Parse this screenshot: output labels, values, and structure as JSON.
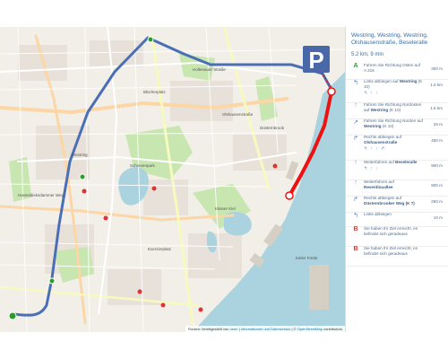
{
  "route": {
    "title": "Westring, Westring, Westring, Olshausenstraße, Beseleralle",
    "summary": "5.2 km, 9 min"
  },
  "steps": [
    {
      "icon": "A",
      "icon_name": "start-marker",
      "pre": "Fahren Sie Richtung Osten auf",
      "bold": "",
      "post": "A 215",
      "dist": "300 m",
      "lanes": ""
    },
    {
      "icon": "↰",
      "icon_name": "turn-left-icon",
      "pre": "Links abbiegen auf",
      "bold": "Westring",
      "post": "(K 10)",
      "dist": "1.5 km",
      "lanes": "↰ ↑ ↑"
    },
    {
      "icon": "↑",
      "icon_name": "straight-icon",
      "pre": "Fahren Sie Richtung Nordosten auf",
      "bold": "Westring",
      "post": "(K 10)",
      "dist": "1.5 km",
      "lanes": ""
    },
    {
      "icon": "↗",
      "icon_name": "slight-right-icon",
      "pre": "Fahren Sie Richtung Norden auf",
      "bold": "Westring",
      "post": "(K 10)",
      "dist": "25 m",
      "lanes": ""
    },
    {
      "icon": "↱",
      "icon_name": "turn-right-icon",
      "pre": "Rechts abbiegen auf",
      "bold": "Olshausenstraße",
      "post": "",
      "dist": "400 m",
      "lanes": "↰ ↑ ↑ ↱"
    },
    {
      "icon": "↑",
      "icon_name": "straight-icon",
      "pre": "Weiterfahren auf",
      "bold": "Beseleralle",
      "post": "",
      "dist": "900 m",
      "lanes": "↰ ↑ ↑"
    },
    {
      "icon": "↑",
      "icon_name": "straight-icon",
      "pre": "Weiterfahren auf",
      "bold": "Reventlouallee",
      "post": "",
      "dist": "800 m",
      "lanes": ""
    },
    {
      "icon": "↱",
      "icon_name": "turn-right-icon",
      "pre": "Rechts abbiegen auf",
      "bold": "Düsternbrooker Weg (K 7)",
      "post": "",
      "dist": "250 m",
      "lanes": ""
    },
    {
      "icon": "↰",
      "icon_name": "turn-left-icon",
      "pre": "Links abbiegen",
      "bold": "",
      "post": "",
      "dist": "10 m",
      "lanes": ""
    },
    {
      "icon": "B",
      "icon_name": "end-marker",
      "pre": "Sie haben Ihr Ziel erreicht, es befindet sich geradeaus",
      "bold": "",
      "post": "",
      "dist": "",
      "lanes": ""
    },
    {
      "icon": "B",
      "icon_name": "end-marker",
      "pre": "Sie haben Ihr Ziel erreicht, es befindet sich geradeaus",
      "bold": "",
      "post": "",
      "dist": "",
      "lanes": ""
    }
  ],
  "attribution": {
    "prefix": "Routen: bereitgestellt von",
    "link1": "osrm",
    "sep": "|",
    "link2": "Informationen und Datenschutz",
    "mid": "| ©",
    "link3": "OpenStreetMap",
    "suffix": "contributors"
  },
  "map_labels": {
    "l1": "Olshausenstraße",
    "l2": "Schrevenpark",
    "l3": "Westring",
    "l4": "Blücherplatz",
    "l5": "Kieler Förde",
    "l6": "Düsternbrook",
    "l7": "Kleiner Kiel",
    "l8": "Holtenauer Straße",
    "l9": "Exerzierplatz",
    "l10": "Hasseldieksdammer Weg"
  },
  "parking_icon": "parking-sign-icon",
  "colors": {
    "route_blue": "#4a6fb5",
    "route_red": "#ee1111",
    "water": "#aad3df",
    "park": "#c8e6b0",
    "land": "#f2efe9"
  }
}
